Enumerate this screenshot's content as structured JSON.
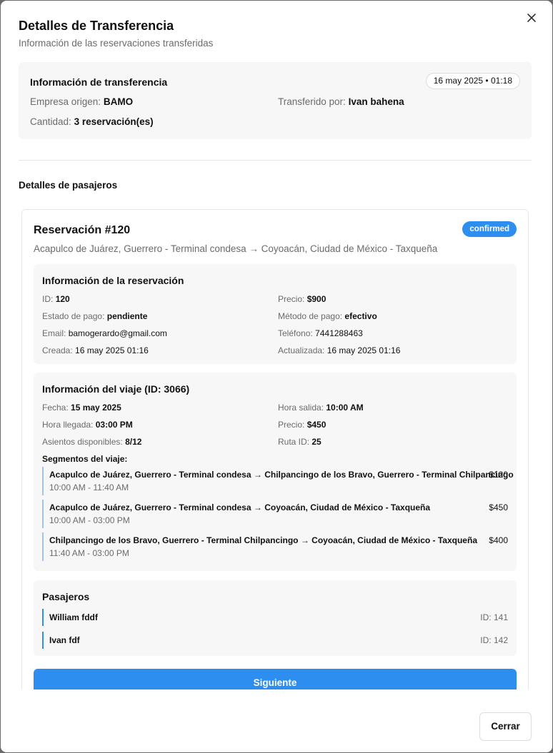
{
  "dialog": {
    "title": "Detalles de Transferencia",
    "subtitle": "Información de las reservaciones transferidas",
    "close_label": "Cerrar"
  },
  "transfer": {
    "heading": "Información de transferencia",
    "datetime": "16 may 2025 • 01:18",
    "origin_label": "Empresa origen:",
    "origin_value": "BAMO",
    "by_label": "Transferido por:",
    "by_value": "Ivan bahena",
    "qty_label": "Cantidad:",
    "qty_value": "3 reservación(es)"
  },
  "passengers_section": {
    "heading": "Detalles de pasajeros"
  },
  "reservation": {
    "title": "Reservación #120",
    "status": "confirmed",
    "route": "Acapulco de Juárez, Guerrero - Terminal condesa → Coyoacán, Ciudad de México - Taxqueña",
    "info": {
      "heading": "Información de la reservación",
      "id_label": "ID:",
      "id_value": "120",
      "price_label": "Precio:",
      "price_value": "$900",
      "pay_status_label": "Estado de pago:",
      "pay_status_value": "pendiente",
      "pay_method_label": "Método de pago:",
      "pay_method_value": "efectivo",
      "email_label": "Email:",
      "email_value": "bamogerardo@gmail.com",
      "phone_label": "Teléfono:",
      "phone_value": "7441288463",
      "created_label": "Creada:",
      "created_value": "16 may 2025 01:16",
      "updated_label": "Actualizada:",
      "updated_value": "16 may 2025 01:16"
    },
    "trip": {
      "heading": "Información del viaje (ID: 3066)",
      "date_label": "Fecha:",
      "date_value": "15 may 2025",
      "depart_label": "Hora salida:",
      "depart_value": "10:00 AM",
      "arrive_label": "Hora llegada:",
      "arrive_value": "03:00 PM",
      "price_label": "Precio:",
      "price_value": "$450",
      "seats_label": "Asientos disponibles:",
      "seats_value": "8/12",
      "route_label": "Ruta ID:",
      "route_value": "25",
      "segments_heading": "Segmentos del viaje:",
      "segments": [
        {
          "route": "Acapulco de Juárez, Guerrero - Terminal condesa → Chilpancingo de los Bravo, Guerrero - Terminal Chilpancingo",
          "time": "10:00 AM - 11:40 AM",
          "price": "$120"
        },
        {
          "route": "Acapulco de Juárez, Guerrero - Terminal condesa → Coyoacán, Ciudad de México - Taxqueña",
          "time": "10:00 AM - 03:00 PM",
          "price": "$450"
        },
        {
          "route": "Chilpancingo de los Bravo, Guerrero - Terminal Chilpancingo → Coyoacán, Ciudad de México - Taxqueña",
          "time": "11:40 AM - 03:00 PM",
          "price": "$400"
        }
      ]
    },
    "passengers": {
      "heading": "Pasajeros",
      "items": [
        {
          "name": "William fddf",
          "id": "ID: 141"
        },
        {
          "name": "Ivan fdf",
          "id": "ID: 142"
        }
      ]
    },
    "next_label": "Siguiente"
  },
  "colors": {
    "accent": "#2d8ef0",
    "segment_border": "#9cc6ee",
    "muted_text": "#6b6b6b",
    "panel_bg": "#f7f7f7"
  }
}
